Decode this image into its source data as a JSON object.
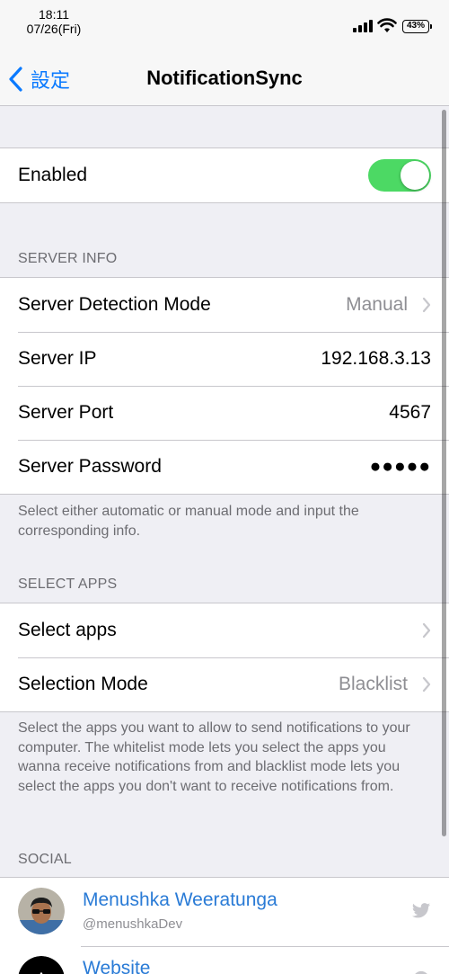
{
  "status_bar": {
    "time": "18:11",
    "date": "07/26(Fri)",
    "battery": "43%"
  },
  "nav": {
    "back_label": "設定",
    "title": "NotificationSync"
  },
  "enabled": {
    "label": "Enabled",
    "on": true,
    "toggle_color": "#4cd964"
  },
  "server_info": {
    "header": "SERVER INFO",
    "rows": [
      {
        "label": "Server Detection Mode",
        "value": "Manual"
      },
      {
        "label": "Server IP",
        "value": "192.168.3.13"
      },
      {
        "label": "Server Port",
        "value": "4567"
      },
      {
        "label": "Server Password",
        "value": "●●●●●"
      }
    ],
    "footer": "Select either automatic or manual mode and input the corresponding info."
  },
  "select_apps": {
    "header": "SELECT APPS",
    "rows": [
      {
        "label": "Select apps"
      },
      {
        "label": "Selection Mode",
        "value": "Blacklist"
      }
    ],
    "footer": "Select the apps you want to allow to send notifications to your computer. The whitelist mode lets you select the apps you wanna receive notifications from and blacklist mode lets you select the apps you don't want to receive notifications from."
  },
  "social": {
    "header": "SOCIAL",
    "rows": [
      {
        "name": "Menushka Weeratunga",
        "handle": "@menushkaDev",
        "icon": "twitter-icon"
      },
      {
        "name": "Website",
        "icon": "safari-icon"
      }
    ]
  },
  "colors": {
    "accent": "#0a7aff",
    "link": "#2a7bd6",
    "background": "#efeff4"
  }
}
